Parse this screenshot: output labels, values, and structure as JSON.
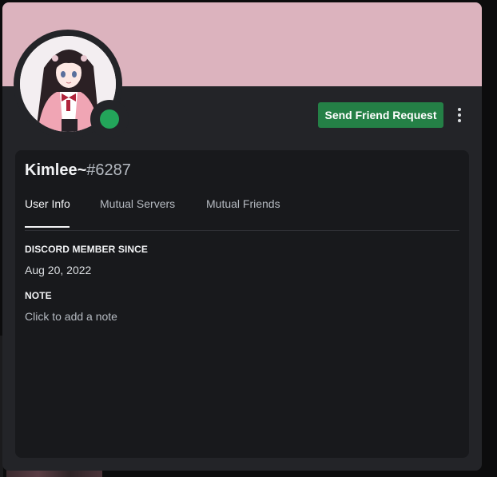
{
  "profile": {
    "username": "Kimlee~",
    "discriminator": "#6287",
    "status": "online",
    "status_color": "#23a55a",
    "banner_color": "#dcb3be",
    "avatar_icon": "anime-girl-avatar"
  },
  "actions": {
    "send_friend_request_label": "Send Friend Request",
    "more_icon": "more-vertical-icon",
    "accent_color": "#248046"
  },
  "tabs": [
    {
      "label": "User Info",
      "active": true
    },
    {
      "label": "Mutual Servers",
      "active": false
    },
    {
      "label": "Mutual Friends",
      "active": false
    }
  ],
  "user_info": {
    "member_since_heading": "DISCORD MEMBER SINCE",
    "member_since_value": "Aug 20, 2022",
    "note_heading": "NOTE",
    "note_placeholder": "Click to add a note"
  }
}
